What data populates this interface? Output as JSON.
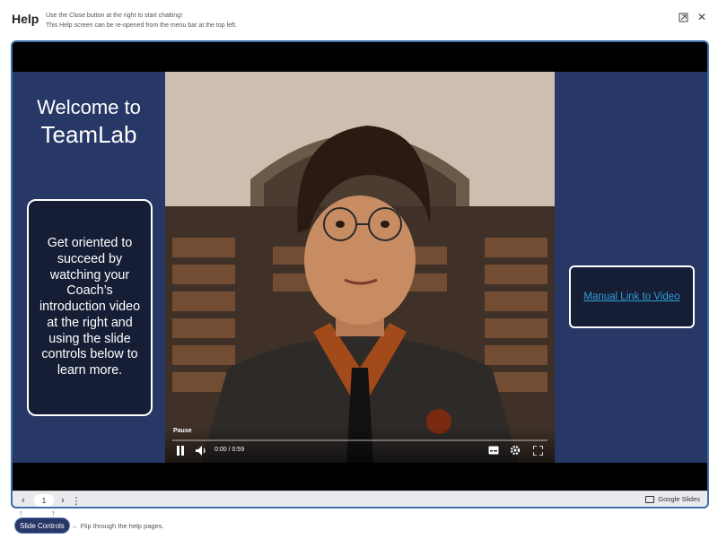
{
  "header": {
    "title": "Help",
    "hint_line1": "Use the Close button at the right to start chatting!",
    "hint_line2": "This Help screen can be re-opened from the menu bar at the top left.",
    "restore_icon": "restore-window-icon",
    "close_label": "✕"
  },
  "slide": {
    "welcome_line1": "Welcome to",
    "welcome_line2": "TeamLab",
    "left_box_text": "Get oriented to succeed by watching your Coach’s introduction video at the right and using the slide controls below to learn more.",
    "manual_link": "Manual Link to Video"
  },
  "video": {
    "tooltip": "Pause",
    "time": "0:00 / 0:59",
    "progress": 0
  },
  "navbar": {
    "page": "1",
    "google_slides": "Google Slides"
  },
  "footer": {
    "slide_controls": "Slide Controls",
    "flip_text": "Flip through the help pages."
  },
  "colors": {
    "accent": "#3d6fa8",
    "slide_bg": "#273766",
    "box_bg": "#161e36",
    "link": "#2f9ed4"
  }
}
